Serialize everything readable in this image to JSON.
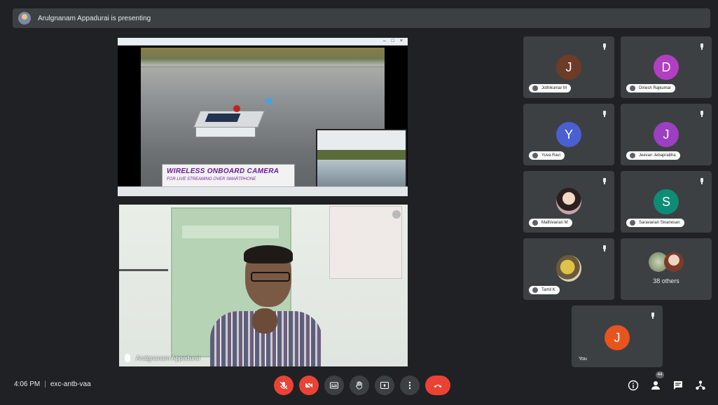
{
  "banner": {
    "text": "Arulgnanam Appadurai is presenting"
  },
  "presentation": {
    "window_title": "",
    "slide_title": "WIRELESS ONBOARD CAMERA",
    "slide_subtitle": "FOR LIVE STREAMING OVER SMARTPHONE"
  },
  "presenter": {
    "name": "Arulgnanam Appadurai"
  },
  "participants": [
    {
      "name": "Jothikumar M",
      "initial": "J",
      "color": "#6d3b26"
    },
    {
      "name": "Dinesh Rajkumar",
      "initial": "D",
      "color": "#b23fc2"
    },
    {
      "name": "Yuva Ravi",
      "initial": "Y",
      "color": "#4a5fd0"
    },
    {
      "name": "Jeevan Jebaprabha",
      "initial": "J",
      "color": "#9c3fc0"
    },
    {
      "name": "Mathivanan M",
      "initial": "",
      "color": "#555"
    },
    {
      "name": "Saravanan Sivanesan",
      "initial": "S",
      "color": "#0e8c76"
    },
    {
      "name": "Tamil K",
      "initial": "",
      "color": "#555"
    }
  ],
  "others": {
    "label": "38 others"
  },
  "self": {
    "label": "You",
    "initial": "J",
    "color": "#e8541e"
  },
  "bottom": {
    "time": "4:06 PM",
    "separator": "|",
    "meeting_code": "exc-antb-vaa",
    "people_count": "44"
  }
}
